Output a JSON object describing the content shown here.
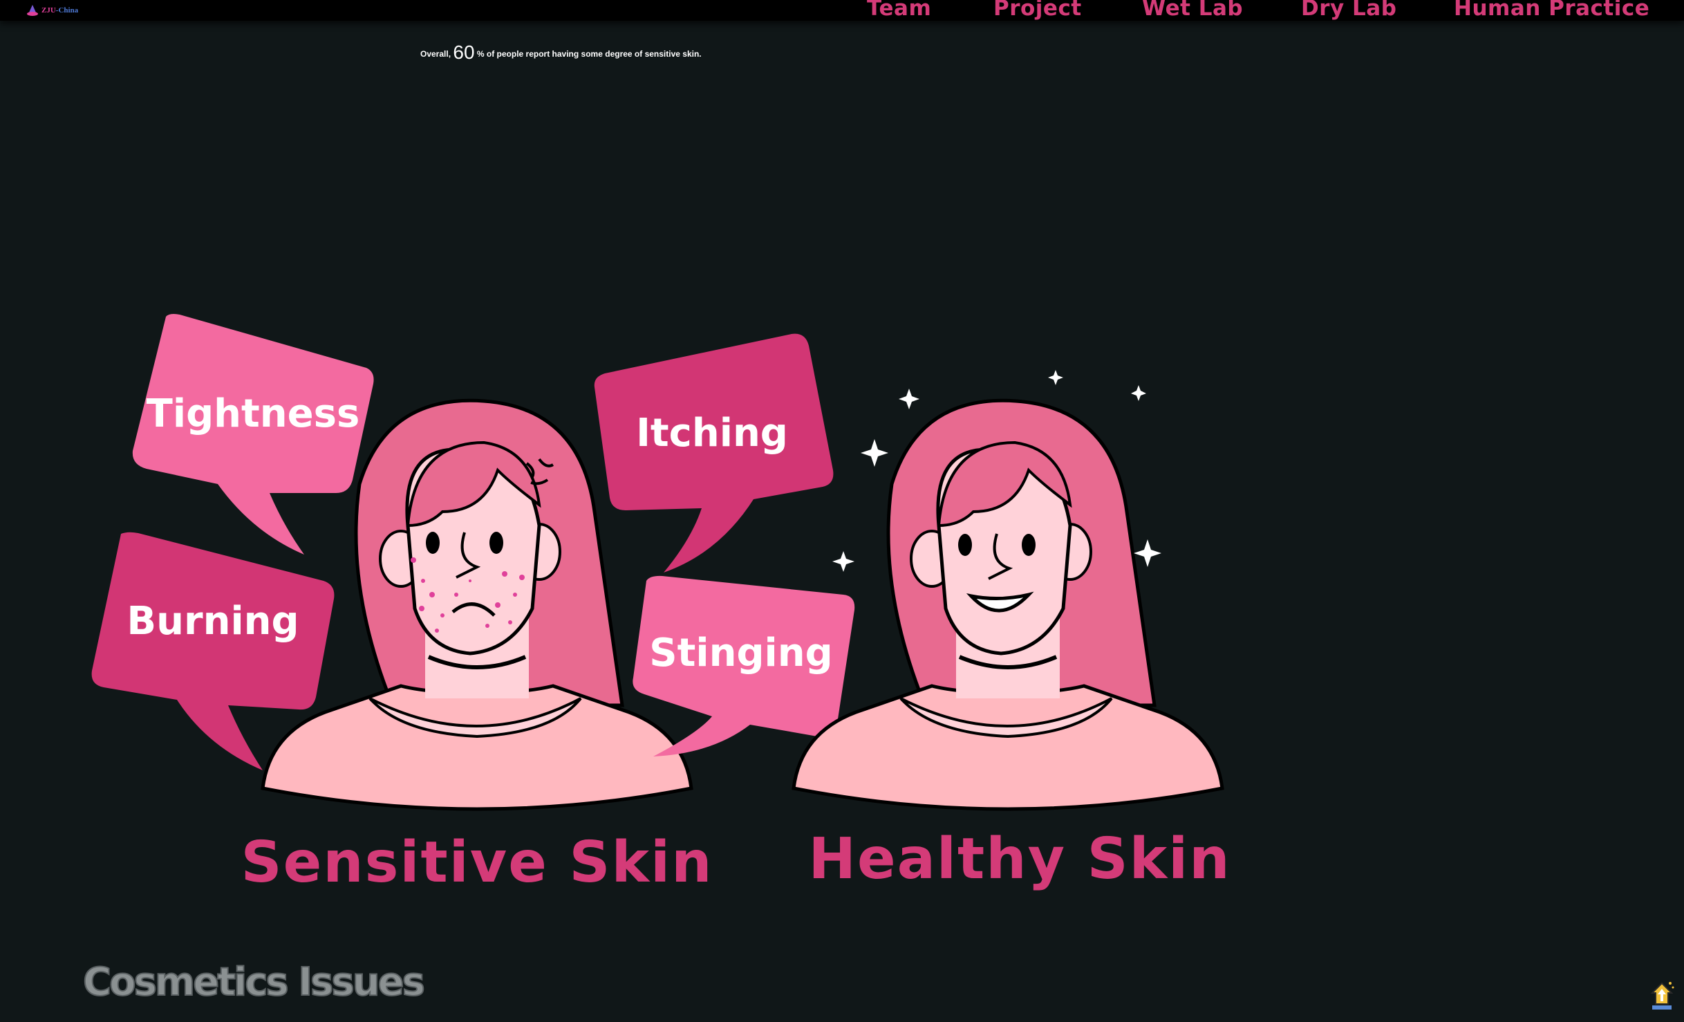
{
  "header": {
    "logo_text": "ZJU",
    "logo_suffix": "-China",
    "nav": [
      {
        "label": "Team"
      },
      {
        "label": "Project"
      },
      {
        "label": "Wet Lab"
      },
      {
        "label": "Dry Lab"
      },
      {
        "label": "Human Practice"
      }
    ]
  },
  "stat": {
    "prefix": "Overall,",
    "value": "60",
    "suffix": "% of people report having some degree of sensitive skin."
  },
  "bubbles": {
    "tightness": "Tightness",
    "itching": "Itching",
    "burning": "Burning",
    "stinging": "Stinging"
  },
  "captions": {
    "sensitive": "Sensitive Skin",
    "healthy": "Healthy Skin"
  },
  "section_title": "Cosmetics Issues",
  "colors": {
    "background": "#101718",
    "accent": "#d43b78",
    "bubble_light": "#f36aa0",
    "bubble_dark": "#d23674",
    "hair": "#e86a90",
    "skin": "#ffd2d9"
  },
  "icons": {
    "back_to_top": "house-arrow-up-icon"
  }
}
